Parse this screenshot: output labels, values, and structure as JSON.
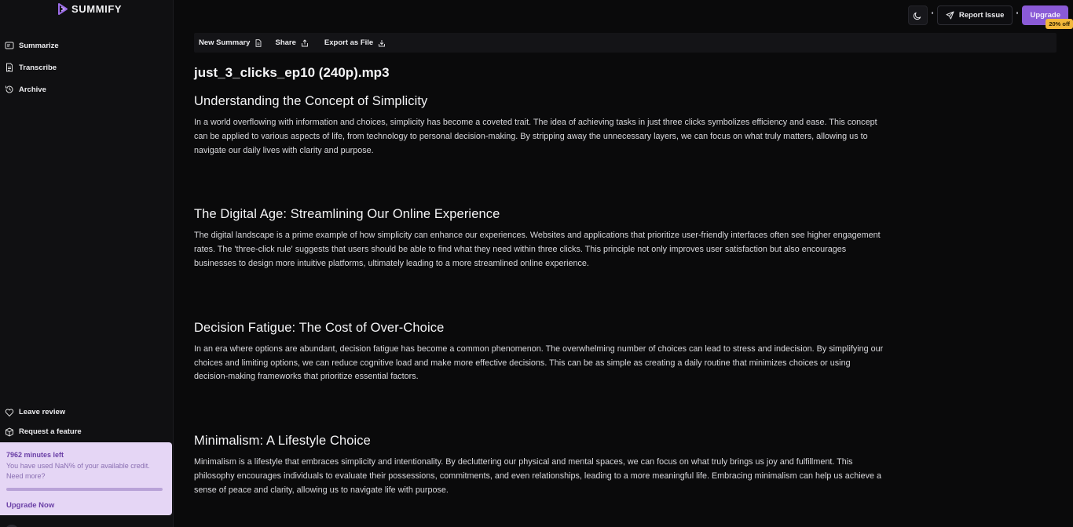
{
  "brand": {
    "name": "SUMMIFY"
  },
  "sidebar": {
    "nav": [
      {
        "label": "Summarize",
        "icon": "summarize-icon"
      },
      {
        "label": "Transcribe",
        "icon": "transcribe-icon"
      },
      {
        "label": "Archive",
        "icon": "archive-icon"
      }
    ],
    "bottom_links": [
      {
        "label": "Leave review",
        "icon": "heart-icon"
      },
      {
        "label": "Request a feature",
        "icon": "box-icon"
      }
    ],
    "credits": {
      "minutes_left": "7962 minutes left",
      "description": "You have used NaN% of your available credit. Need more?",
      "progress": 0,
      "upgrade_label": "Upgrade Now"
    }
  },
  "header": {
    "report_label": "Report Issue",
    "upgrade_label": "Upgrade",
    "discount_label": "20% off"
  },
  "toolbar": {
    "new_summary": "New Summary",
    "share": "Share",
    "export": "Export as File"
  },
  "document": {
    "file_title": "just_3_clicks_ep10 (240p).mp3",
    "sections": [
      {
        "heading": "Understanding the Concept of Simplicity",
        "body": "In a world overflowing with information and choices, simplicity has become a coveted trait. The idea of achieving tasks in just three clicks symbolizes efficiency and ease. This concept can be applied to various aspects of life, from technology to personal decision-making. By stripping away the unnecessary layers, we can focus on what truly matters, allowing us to navigate our daily lives with clarity and purpose."
      },
      {
        "heading": "The Digital Age: Streamlining Our Online Experience",
        "body": "The digital landscape is a prime example of how simplicity can enhance our experiences. Websites and applications that prioritize user-friendly interfaces often see higher engagement rates. The 'three-click rule' suggests that users should be able to find what they need within three clicks. This principle not only improves user satisfaction but also encourages businesses to design more intuitive platforms, ultimately leading to a more streamlined online experience."
      },
      {
        "heading": "Decision Fatigue: The Cost of Over-Choice",
        "body": "In an era where options are abundant, decision fatigue has become a common phenomenon. The overwhelming number of choices can lead to stress and indecision. By simplifying our choices and limiting options, we can reduce cognitive load and make more effective decisions. This can be as simple as creating a daily routine that minimizes choices or using decision-making frameworks that prioritize essential factors."
      },
      {
        "heading": "Minimalism: A Lifestyle Choice",
        "body": "Minimalism is a lifestyle that embraces simplicity and intentionality. By decluttering our physical and mental spaces, we can focus on what truly brings us joy and fulfillment. This philosophy encourages individuals to evaluate their possessions, commitments, and even relationships, leading to a more meaningful life. Embracing minimalism can help us achieve a sense of peace and clarity, allowing us to navigate life with purpose."
      }
    ]
  },
  "colors": {
    "background": "#0a0a0b",
    "sidebar": "#101012",
    "accent": "#8a5ad6",
    "badge": "#f2b73a",
    "credit_card": "#e5d6f5"
  }
}
